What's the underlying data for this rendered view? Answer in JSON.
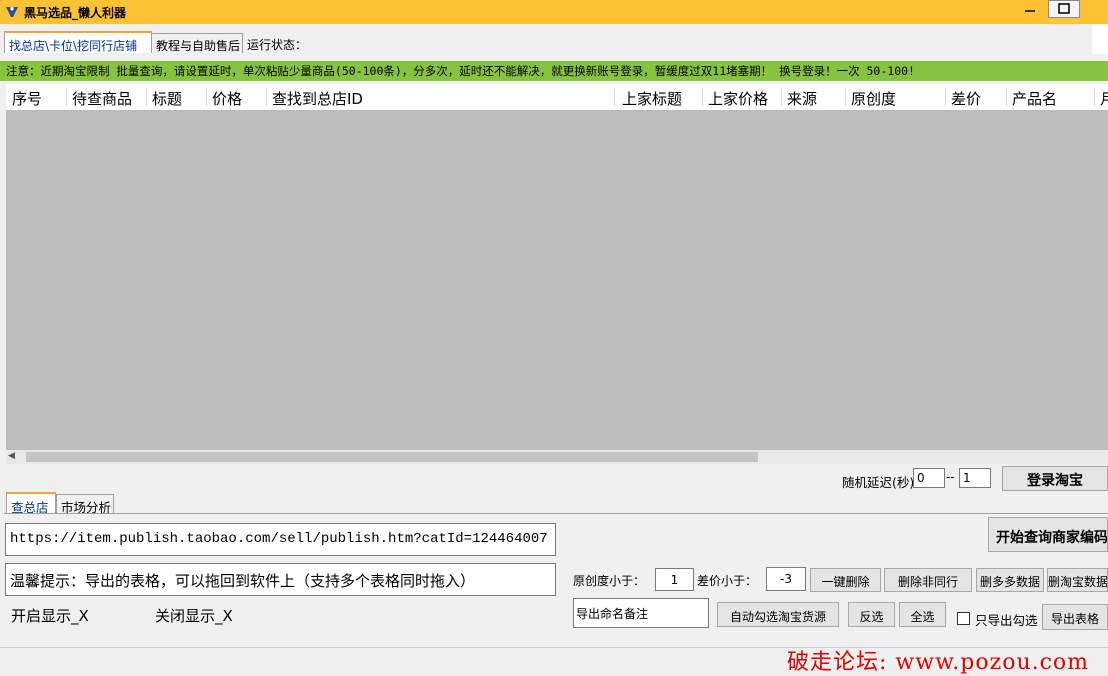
{
  "window": {
    "title": "黑马选品_懒人利器",
    "colors": {
      "titlebar": "#fdc334",
      "notice_bg": "#86c440",
      "grid_bg": "#bcbcbc",
      "watermark": "#e00000"
    }
  },
  "tabs": [
    {
      "label": "找总店\\卡位\\挖同行店铺",
      "active": true
    },
    {
      "label": "教程与自助售后",
      "active": false
    }
  ],
  "run_status_label": "运行状态：",
  "notice": "注意：近期淘宝限制 批量查询，请设置延时，单次粘贴少量商品(50-100条)，分多次，延时还不能解决，就更换新账号登录，暂缓度过双11堵塞期！ 换号登录！一次 50-100!",
  "grid": {
    "columns": [
      "序号",
      "待查商品",
      "标题",
      "价格",
      "查找到总店ID",
      "上家标题",
      "上家价格",
      "来源",
      "原创度",
      "差价",
      "产品名",
      "月"
    ]
  },
  "delay": {
    "label": "随机延迟(秒)",
    "from": "0",
    "separator": "--",
    "to": "1"
  },
  "login_button": "登录淘宝",
  "bottom_tabs": [
    {
      "label": "查总店",
      "active": true
    },
    {
      "label": "市场分析",
      "active": false
    }
  ],
  "url_value": "https://item.publish.taobao.com/sell/publish.htm?catId=124464007",
  "tip_text": "温馨提示：导出的表格，可以拖回到软件上（支持多个表格同时拖入）",
  "show_on": "开启显示_X",
  "show_off": "关闭显示_X",
  "query_button": "开始查询商家编码",
  "filters": {
    "orig_label": "原创度小于：",
    "orig_value": "1",
    "diff_label": "差价小于：",
    "diff_value": "-3"
  },
  "action_buttons": {
    "delete_one_click": "一键删除",
    "delete_non_peer": "删除非同行",
    "delete_multi": "删多多数据",
    "delete_taobao": "删淘宝数据"
  },
  "export_note": "导出命名备注",
  "auto_select_button": "自动勾选淘宝货源",
  "invert_button": "反选",
  "select_all_button": "全选",
  "export_checked_label": "只导出勾选",
  "export_button": "导出表格",
  "watermark": "破走论坛: www.pozou.com"
}
